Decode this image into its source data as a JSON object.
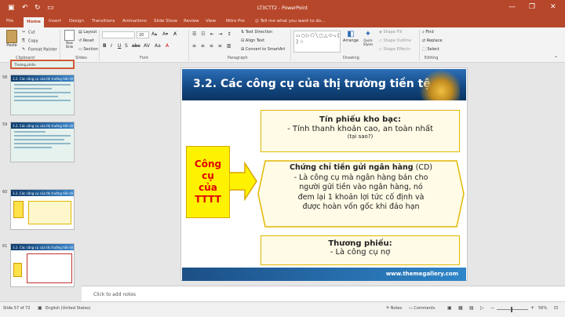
{
  "app": {
    "title": "LT3CTT2 - PowerPoint",
    "brand_color": "#b7472a"
  },
  "quick_access": {
    "save_icon": "save-icon",
    "undo_icon": "undo-icon",
    "redo_icon": "redo-icon",
    "present_icon": "present-icon"
  },
  "tabs": [
    "File",
    "Home",
    "Insert",
    "Design",
    "Transitions",
    "Animations",
    "Slide Show",
    "Review",
    "View",
    "Nitro Pro"
  ],
  "tell_me": "Tell me what you want to do...",
  "ribbon": {
    "clipboard": {
      "label": "Clipboard",
      "paste": "Paste",
      "cut": "Cut",
      "copy": "Copy",
      "format_painter": "Format Painter"
    },
    "slides": {
      "label": "Slides",
      "new_slide": "New Slide",
      "layout": "Layout",
      "reset": "Reset",
      "section": "Section"
    },
    "font": {
      "label": "Font",
      "size": "20"
    },
    "paragraph": {
      "label": "Paragraph",
      "text_direction": "Text Direction",
      "align_text": "Align Text",
      "smartart": "Convert to SmartArt"
    },
    "drawing": {
      "label": "Drawing",
      "arrange": "Arrange",
      "quick_styles": "Quick Styles",
      "shape_fill": "Shape Fill",
      "shape_outline": "Shape Outline",
      "shape_effects": "Shape Effects"
    },
    "editing": {
      "label": "Editing",
      "find": "Find",
      "replace": "Replace",
      "select": "Select"
    }
  },
  "thumbnails": [
    {
      "num": "",
      "title": "Thương phiếu"
    },
    {
      "num": "58",
      "title": "3.2. Các công cụ của thị trường tiền tệ"
    },
    {
      "num": "59",
      "title": "3.2. Các công cụ của thị trường tiền tệ"
    },
    {
      "num": "60",
      "title": "3.2. Các công cụ của thị trường tiền tệ"
    },
    {
      "num": "61",
      "title": "3.2. Các công cụ của thị trường tiền tệ"
    }
  ],
  "slide": {
    "title": "3.2. Các công cụ của thị trường tiền tệ",
    "center_label": [
      "Công",
      "cụ",
      "của",
      "TTTT"
    ],
    "box1": {
      "heading": "Tín phiếu kho bạc:",
      "line1": "- Tính thanh khoản cao, an toàn nhất",
      "line2": "(tại sao?)"
    },
    "box2": {
      "heading": "Chứng chỉ tiền gửi ngân hàng",
      "heading_suffix": " (CD)",
      "lines": [
        "- Là công cụ mà ngân hàng bán cho",
        "người gửi tiền vào ngân hàng, nó",
        "đem lại 1 khoản lợi tức cố định và",
        "được hoàn vốn gốc khi đáo hạn"
      ]
    },
    "box3": {
      "heading": "Thương phiếu:",
      "line1": "- Là công cụ nợ"
    },
    "footer_url": "www.themegallery.com"
  },
  "notes_placeholder": "Click to add notes",
  "status": {
    "slide": "Slide 57 of 72",
    "language": "English (United States)",
    "notes": "Notes",
    "comments": "Comments",
    "zoom": "56%"
  }
}
